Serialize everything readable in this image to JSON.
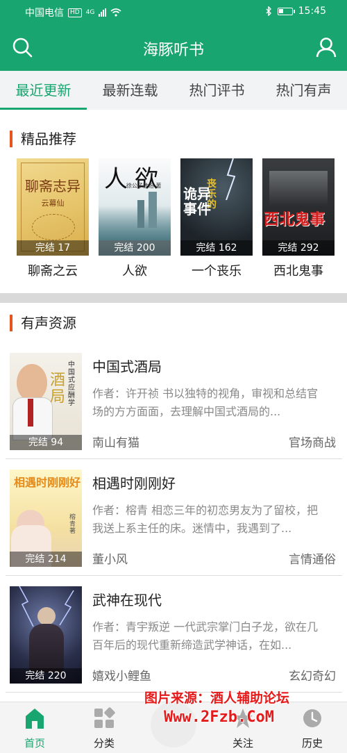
{
  "status_bar": {
    "carrier": "中国电信",
    "hd": "HD",
    "network": "4G",
    "time": "15:45"
  },
  "app_bar": {
    "title": "海豚听书",
    "search_icon": "search-icon",
    "user_icon": "user-icon"
  },
  "tabs": [
    {
      "label": "最近更新",
      "active": true
    },
    {
      "label": "最新连载",
      "active": false
    },
    {
      "label": "热门评书",
      "active": false
    },
    {
      "label": "热门有声",
      "active": false
    }
  ],
  "recommend": {
    "title": "精品推荐",
    "books": [
      {
        "name": "聊斋之云",
        "status": "完结 17",
        "cover_title": "聊斋志异",
        "cover_sub": "云幕仙"
      },
      {
        "name": "人欲",
        "status": "完结 200",
        "cover_title": "人欲",
        "cover_sub": "徐公子胜治 著"
      },
      {
        "name": "一个丧乐",
        "status": "完结 162",
        "cover_title": "诡异事件",
        "cover_sub": "丧乐的"
      },
      {
        "name": "西北鬼事",
        "status": "完结 292",
        "cover_title": "西北鬼事",
        "cover_sub": ""
      }
    ]
  },
  "audio": {
    "title": "有声资源",
    "items": [
      {
        "name": "中国式酒局",
        "desc": "作者：许开祯 书以独特的视角，审视和总结官场的方方面面，去理解中国式酒局的...",
        "author": "南山有猫",
        "genre": "官场商战",
        "status": "完结 94",
        "cover_title": "酒局",
        "cover_sub": "中国式 应酬学"
      },
      {
        "name": "相遇时刚刚好",
        "desc": "作者：榕青 相恋三年的初恋男友为了留校，把我送上系主任的床。迷情中，我遇到了...",
        "author": "董小风",
        "genre": "言情通俗",
        "status": "完结 214",
        "cover_title": "相遇时刚刚好",
        "cover_sub": "榕青 著"
      },
      {
        "name": "武神在现代",
        "desc": "作者：青宇叛逆 一代武宗掌门白子龙，欲在几百年后的现代重新缔造武学神话，在如...",
        "author": "嬉戏小鲤鱼",
        "genre": "玄幻奇幻",
        "status": "完结 220",
        "cover_title": "",
        "cover_sub": ""
      }
    ]
  },
  "bottom_nav": [
    {
      "label": "首页",
      "icon": "home-icon",
      "active": true
    },
    {
      "label": "分类",
      "icon": "category-icon",
      "active": false
    },
    {
      "label": "关注",
      "icon": "star-icon",
      "active": false
    },
    {
      "label": "历史",
      "icon": "history-icon",
      "active": false
    }
  ],
  "watermark": {
    "line1": "图片来源：酒人辅助论坛",
    "line2": "Www.2Fzb.CoM"
  },
  "colors": {
    "brand": "#18a56f",
    "accent": "#e8521c"
  }
}
